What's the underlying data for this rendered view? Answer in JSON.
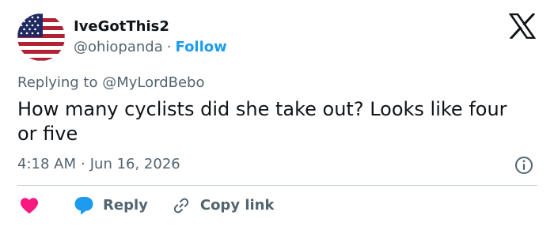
{
  "author": {
    "display_name": "IveGotThis2",
    "handle": "@ohiopanda",
    "separator": "·",
    "follow_label": "Follow",
    "avatar_icon": "us-flag-avatar"
  },
  "brand": {
    "logo_icon": "x-logo-icon"
  },
  "reply_context": {
    "prefix": "Replying to",
    "mention": "@MyLordBebo"
  },
  "tweet": {
    "text": "How many cyclists did she take out? Looks like four or five",
    "time": "4:18 AM",
    "separator": "·",
    "date": "Jun 16, 2026"
  },
  "actions": {
    "like_icon": "heart-icon",
    "reply_label": "Reply",
    "reply_icon": "speech-bubble-icon",
    "copy_label": "Copy link",
    "copy_icon": "link-icon"
  },
  "colors": {
    "text": "#0f1419",
    "secondary": "#536471",
    "accent": "#1d9bf0",
    "heart": "#f91880",
    "divider": "#cfd9de"
  }
}
